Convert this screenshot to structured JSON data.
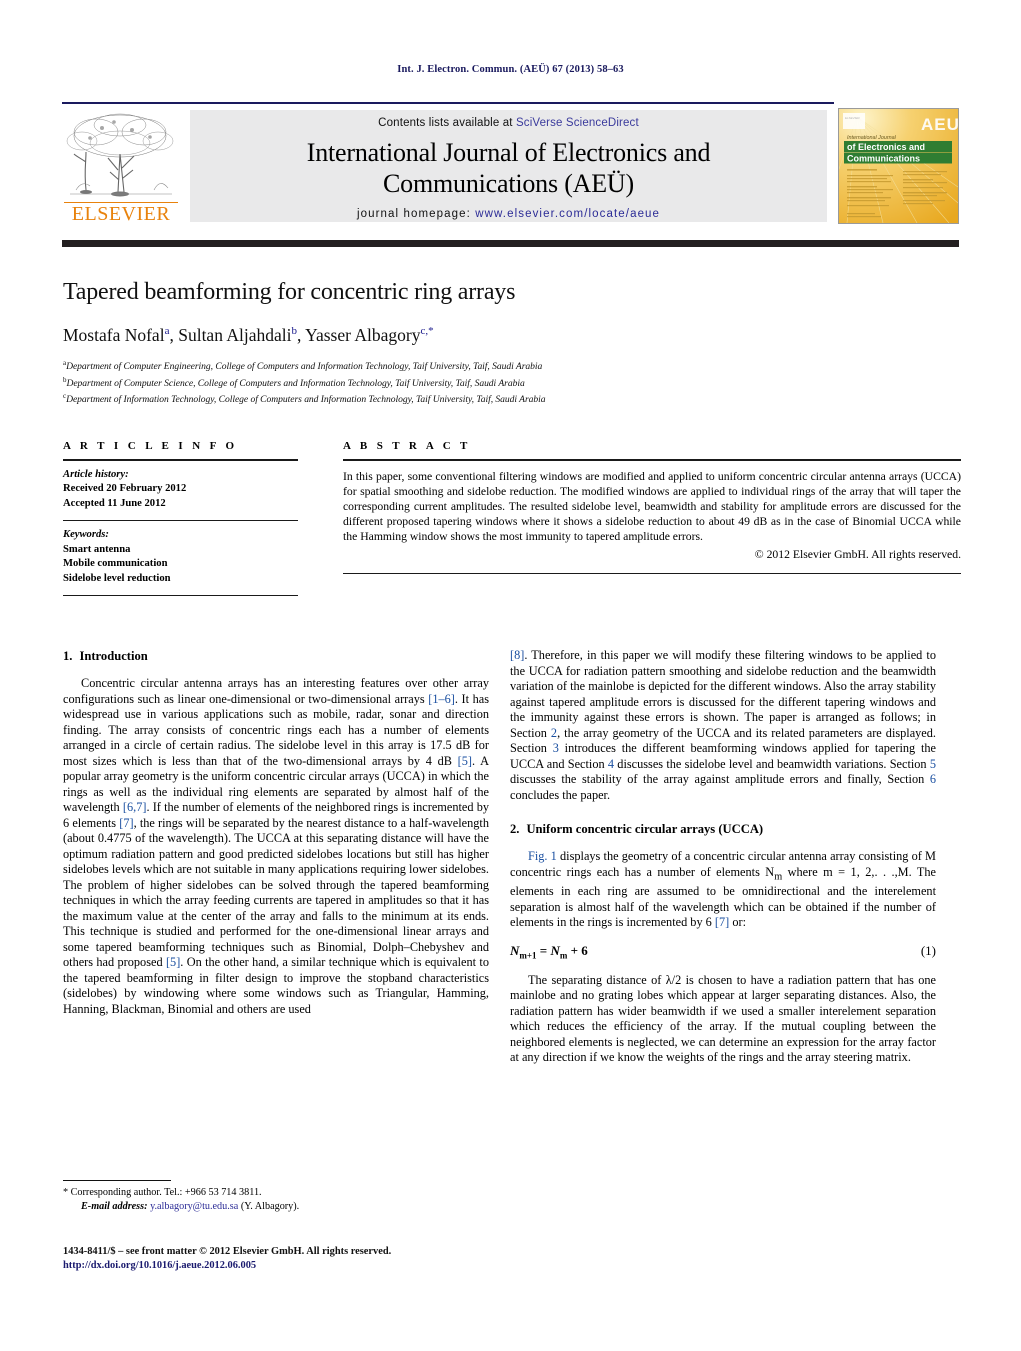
{
  "running_head": "Int. J. Electron. Commun. (AEÜ) 67 (2013) 58–63",
  "masthead": {
    "contents_prefix": "Contents lists available at ",
    "contents_link": "SciVerse ScienceDirect",
    "journal_title_line1": "International Journal of Electronics and",
    "journal_title_line2": "Communications (AEÜ)",
    "homepage_prefix": "journal homepage: ",
    "homepage_url": "www.elsevier.com/locate/aeue",
    "publisher_logo_text": "ELSEVIER",
    "cover": {
      "aeu_badge": "AEU",
      "cover_line1": "International Journal",
      "cover_line2": "of Electronics and",
      "cover_line3": "Communications"
    }
  },
  "colors": {
    "link_blue": "#1a4fa0",
    "navy": "#1a1a5e",
    "elsevier_orange": "#e8820c",
    "band_gray": "#e9e9ea",
    "cover_gold": "#f0c040",
    "cover_green": "#2f7d32"
  },
  "article": {
    "title": "Tapered beamforming for concentric ring arrays",
    "authors_html": "Mostafa Nofal<sup>a</sup>, Sultan Aljahdali<sup>b</sup>, Yasser Albagory<sup>c,*</sup>",
    "affiliations": [
      {
        "marker": "a",
        "text": "Department of Computer Engineering, College of Computers and Information Technology, Taif University, Taif, Saudi Arabia"
      },
      {
        "marker": "b",
        "text": "Department of Computer Science, College of Computers and Information Technology, Taif University, Taif, Saudi Arabia"
      },
      {
        "marker": "c",
        "text": "Department of Information Technology, College of Computers and Information Technology, Taif University, Taif, Saudi Arabia"
      }
    ]
  },
  "article_info": {
    "heading": "A R T I C L E   I N F O",
    "history_label": "Article history:",
    "history_lines": [
      "Received 20 February 2012",
      "Accepted 11 June 2012"
    ],
    "keywords_label": "Keywords:",
    "keywords": [
      "Smart antenna",
      "Mobile communication",
      "Sidelobe level reduction"
    ]
  },
  "abstract": {
    "heading": "A B S T R A C T",
    "text": "In this paper, some conventional filtering windows are modified and applied to uniform concentric circular antenna arrays (UCCA) for spatial smoothing and sidelobe reduction. The modified windows are applied to individual rings of the array that will taper the corresponding current amplitudes. The resulted sidelobe level, beamwidth and stability for amplitude errors are discussed for the different proposed tapering windows where it shows a sidelobe reduction to about 49 dB as in the case of Binomial UCCA while the Hamming window shows the most immunity to tapered amplitude errors.",
    "copyright": "© 2012 Elsevier GmbH. All rights reserved."
  },
  "sections": {
    "intro": {
      "number": "1.",
      "title": "Introduction",
      "p1_a": "Concentric circular antenna arrays has an interesting features over other array configurations such as linear one-dimensional or two-dimensional arrays ",
      "p1_r1": "[1–6]",
      "p1_b": ". It has widespread use in various applications such as mobile, radar, sonar and direction finding. The array consists of concentric rings each has a number of elements arranged in a circle of certain radius. The sidelobe level in this array is 17.5 dB for most sizes which is less than that of the two-dimensional arrays by 4 dB ",
      "p1_r2": "[5]",
      "p1_c": ". A popular array geometry is the uniform concentric circular arrays (UCCA) in which the rings as well as the individual ring elements are separated by almost half of the wavelength ",
      "p1_r3": "[6,7]",
      "p1_d": ". If the number of elements of the neighbored rings is incremented by 6 elements ",
      "p1_r4": "[7]",
      "p1_e": ", the rings will be separated by the nearest distance to a half-wavelength (about 0.4775 of the wavelength). The UCCA at this separating distance will have the optimum radiation pattern and good predicted sidelobes locations but still has higher sidelobes levels which are not suitable in many applications requiring lower sidelobes. The problem of higher sidelobes can be solved through the tapered beamforming techniques in which the array feeding currents are tapered in amplitudes so that it has the maximum value at the center of the array and falls to the minimum at its ends. This technique is studied and performed for the one-dimensional linear arrays and some tapered beamforming techniques such as Binomial, Dolph–Chebyshev and others had proposed ",
      "p1_r5": "[5]",
      "p1_f": ". On the other hand, a similar technique which is equivalent to the tapered beamforming in filter design to improve the stopband characteristics (sidelobes) by windowing where some windows such as Triangular, Hamming, Hanning, Blackman, Binomial and others are used ",
      "p1_r6": "[8]",
      "p1_g": ". Therefore, in this paper we will modify these filtering windows to be applied to the UCCA for radiation pattern smoothing and sidelobe reduction and the beamwidth variation of the mainlobe is depicted for the different windows. Also the array stability against tapered amplitude errors is discussed for the different tapering windows and the immunity against these errors is shown. The paper is arranged as follows; in Section ",
      "p1_s2": "2",
      "p1_h": ", the array geometry of the UCCA and its related parameters are displayed. Section ",
      "p1_s3": "3",
      "p1_i": " introduces the different beamforming windows applied for tapering the UCCA and Section ",
      "p1_s4": "4",
      "p1_j": " discusses the sidelobe level and beamwidth variations. Section ",
      "p1_s5": "5",
      "p1_k": " discusses the stability of the array against amplitude errors and finally, Section ",
      "p1_s6": "6",
      "p1_l": " concludes the paper."
    },
    "ucca": {
      "number": "2.",
      "title": "Uniform concentric circular arrays (UCCA)",
      "p1_fig": "Fig. 1",
      "p1_a": " displays the geometry of a concentric circular antenna array consisting of M concentric rings each has a number of elements N",
      "p1_sub": "m",
      "p1_b": " where m = 1, 2,. . .,M. The elements in each ring are assumed to be omnidirectional and the interelement separation is almost half of the wavelength which can be obtained if the number of elements in the rings is incremented by 6 ",
      "p1_r7": "[7]",
      "p1_c": " or:",
      "equation": "N",
      "equation_full": "Nm+1 = Nm + 6",
      "equation_number": "(1)",
      "p2": "The separating distance of λ/2 is chosen to have a radiation pattern that has one mainlobe and no grating lobes which appear at larger separating distances. Also, the radiation pattern has wider beamwidth if we used a smaller interelement separation which reduces the efficiency of the array. If the mutual coupling between the neighbored elements is neglected, we can determine an expression for the array factor at any direction if we know the weights of the rings and the array steering matrix."
    }
  },
  "footer": {
    "corresponding": "* Corresponding author. Tel.: +966 53 714 3811.",
    "email_label": "E-mail address:",
    "email": "y.albagory@tu.edu.sa",
    "email_suffix": " (Y. Albagory).",
    "issn_line": "1434-8411/$ – see front matter © 2012 Elsevier GmbH. All rights reserved.",
    "doi_line": "http://dx.doi.org/10.1016/j.aeue.2012.06.005"
  }
}
